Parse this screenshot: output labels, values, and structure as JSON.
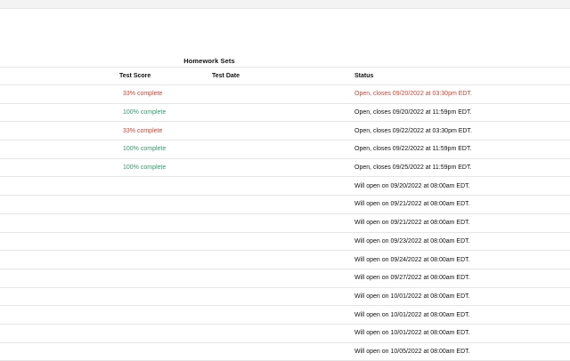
{
  "colors": {
    "partial": "#d9412f",
    "complete": "#2f9e6e",
    "status_warning": "#d9412f"
  },
  "section_title": "Homework Sets",
  "columns": {
    "score": "Test Score",
    "date": "Test Date",
    "status": "Status"
  },
  "rows": [
    {
      "score": "33% complete",
      "score_state": "partial",
      "date": "",
      "status": "Open, closes 09/20/2022 at 03:30pm EDT.",
      "status_state": "warning"
    },
    {
      "score": "100% complete",
      "score_state": "complete",
      "date": "",
      "status": "Open, closes 09/20/2022 at 11:59pm EDT.",
      "status_state": "normal"
    },
    {
      "score": "33% complete",
      "score_state": "partial",
      "date": "",
      "status": "Open, closes 09/22/2022 at 03:30pm EDT.",
      "status_state": "normal"
    },
    {
      "score": "100% complete",
      "score_state": "complete",
      "date": "",
      "status": "Open, closes 09/22/2022 at 11:59pm EDT.",
      "status_state": "normal"
    },
    {
      "score": "100% complete",
      "score_state": "complete",
      "date": "",
      "status": "Open, closes 09/25/2022 at 11:59pm EDT.",
      "status_state": "normal"
    },
    {
      "score": "",
      "score_state": "",
      "date": "",
      "status": "Will open on 09/20/2022 at 08:00am EDT.",
      "status_state": "normal"
    },
    {
      "score": "",
      "score_state": "",
      "date": "",
      "status": "Will open on 09/21/2022 at 08:00am EDT.",
      "status_state": "normal"
    },
    {
      "score": "",
      "score_state": "",
      "date": "",
      "status": "Will open on 09/21/2022 at 08:00am EDT.",
      "status_state": "normal"
    },
    {
      "score": "",
      "score_state": "",
      "date": "",
      "status": "Will open on 09/23/2022 at 08:00am EDT.",
      "status_state": "normal"
    },
    {
      "score": "",
      "score_state": "",
      "date": "",
      "status": "Will open on 09/24/2022 at 08:00am EDT.",
      "status_state": "normal"
    },
    {
      "score": "",
      "score_state": "",
      "date": "",
      "status": "Will open on 09/27/2022 at 08:00am EDT.",
      "status_state": "normal"
    },
    {
      "score": "",
      "score_state": "",
      "date": "",
      "status": "Will open on 10/01/2022 at 08:00am EDT.",
      "status_state": "normal"
    },
    {
      "score": "",
      "score_state": "",
      "date": "",
      "status": "Will open on 10/01/2022 at 08:00am EDT.",
      "status_state": "normal"
    },
    {
      "score": "",
      "score_state": "",
      "date": "",
      "status": "Will open on 10/01/2022 at 08:00am EDT.",
      "status_state": "normal"
    },
    {
      "score": "",
      "score_state": "",
      "date": "",
      "status": "Will open on 10/05/2022 at 08:00am EDT.",
      "status_state": "normal"
    }
  ]
}
